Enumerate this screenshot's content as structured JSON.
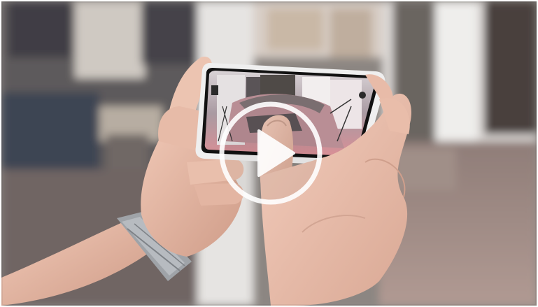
{
  "player": {
    "state": "paused",
    "overlay_icon": "play-icon",
    "accent_color": "#ffffff"
  },
  "scene": {
    "wall_color": "#e9e6e3",
    "floor_color": "#9e8a83",
    "skin_color": "#e2b8a6",
    "phone_frame_color": "#f1f1f1",
    "watch_color": "#9a9ea3"
  }
}
